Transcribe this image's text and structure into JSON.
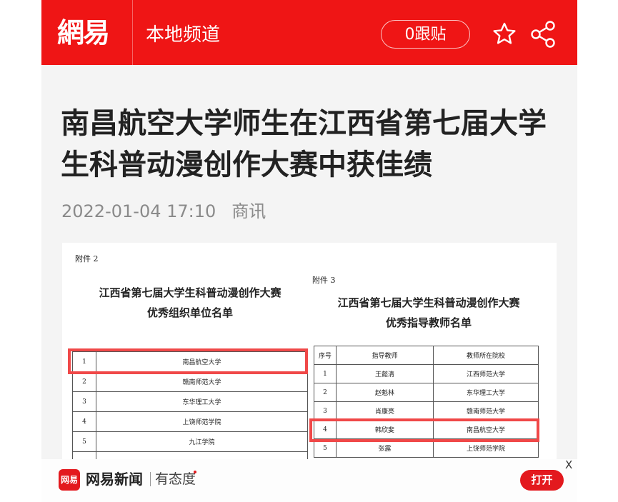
{
  "header": {
    "logo": "網易",
    "channel": "本地频道",
    "follow_button": "0跟贴",
    "icons": [
      "star-icon",
      "share-icon"
    ]
  },
  "article": {
    "title": "南昌航空大学师生在江西省第七届大学生科普动漫创作大赛中获佳绩",
    "date": "2022-01-04 17:10",
    "source": "商讯"
  },
  "image": {
    "left": {
      "attachment": "附件 2",
      "title_line1": "江西省第七届大学生科普动漫创作大赛",
      "title_line2": "优秀组织单位名单",
      "rows": [
        {
          "no": "1",
          "name": "南昌航空大学"
        },
        {
          "no": "2",
          "name": "赣南师范大学"
        },
        {
          "no": "3",
          "name": "东华理工大学"
        },
        {
          "no": "4",
          "name": "上饶师范学院"
        },
        {
          "no": "5",
          "name": "九江学院"
        }
      ]
    },
    "right": {
      "attachment": "附件 3",
      "title_line1": "江西省第七届大学生科普动漫创作大赛",
      "title_line2": "优秀指导教师名单",
      "headers": [
        "序号",
        "指导教师",
        "教师所在院校"
      ],
      "rows": [
        {
          "no": "1",
          "teacher": "王懿清",
          "school": "江西师范大学"
        },
        {
          "no": "2",
          "teacher": "赵魁林",
          "school": "东华理工大学"
        },
        {
          "no": "3",
          "teacher": "肖康亮",
          "school": "赣南师范大学"
        },
        {
          "no": "4",
          "teacher": "韩欣斐",
          "school": "南昌航空大学"
        },
        {
          "no": "5",
          "teacher": "张露",
          "school": "上饶师范学院"
        }
      ]
    }
  },
  "banner": {
    "icon_text": "网易",
    "app_name": "网易新闻",
    "slogan": "有态度",
    "open_button": "打开",
    "close": "X"
  },
  "colors": {
    "brand_red": "#ef1515",
    "highlight": "#f04848"
  }
}
